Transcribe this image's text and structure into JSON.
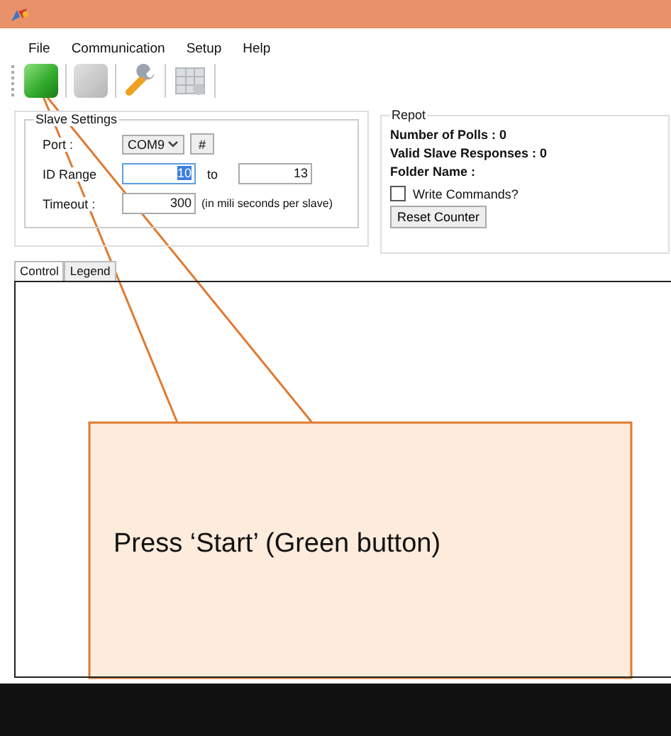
{
  "menu": [
    "File",
    "Communication",
    "Setup",
    "Help"
  ],
  "toolbar": [
    {
      "kind": "start",
      "disabled": false
    },
    {
      "kind": "stop",
      "disabled": true
    },
    {
      "kind": "tools",
      "disabled": false
    },
    {
      "kind": "grid",
      "disabled": true
    }
  ],
  "slave_settings": {
    "title": "Slave Settings",
    "port_label": "Port :",
    "port_value": "COM9",
    "port_button": "#",
    "id_range_label": "ID Range",
    "id_from": "10",
    "to_label": "to",
    "id_to": "13",
    "timeout_label": "Timeout :",
    "timeout_value": "300",
    "timeout_hint": "(in mili seconds per slave)"
  },
  "report": {
    "title": "Repot",
    "lines": [
      "Number of Polls : 0",
      "Valid Slave Responses : 0",
      "Folder Name :"
    ],
    "write_commands": {
      "label": "Write Commands?",
      "checked": false
    },
    "reset_button": "Reset Counter"
  },
  "tabs": [
    {
      "label": "Control",
      "selected": true
    },
    {
      "label": "Legend",
      "selected": false
    }
  ],
  "callout": {
    "text": "Press ‘Start’ (Green button)"
  }
}
